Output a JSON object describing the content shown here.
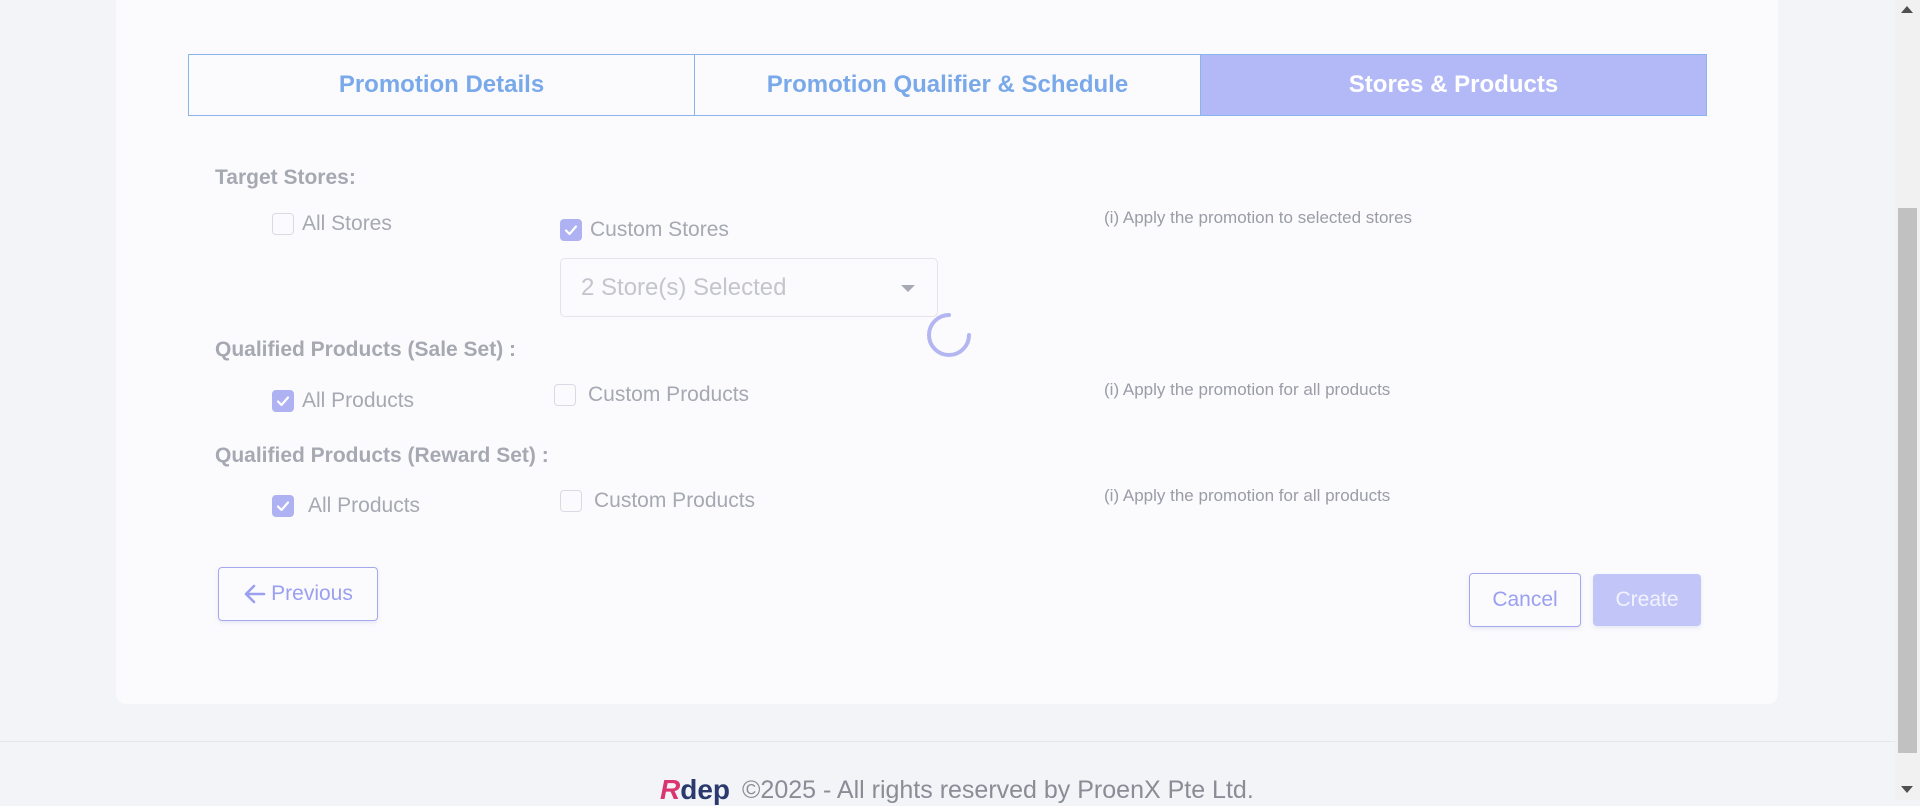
{
  "tabs": [
    {
      "label": "Promotion Details",
      "active": false
    },
    {
      "label": "Promotion Qualifier & Schedule",
      "active": false
    },
    {
      "label": "Stores & Products",
      "active": true
    }
  ],
  "target_stores": {
    "label": "Target Stores:",
    "all_label": "All Stores",
    "all_checked": false,
    "custom_label": "Custom Stores",
    "custom_checked": true,
    "select_value": "2 Store(s) Selected",
    "hint": "(i) Apply the promotion to selected stores"
  },
  "sale_set": {
    "label": "Qualified Products (Sale Set) :",
    "all_label": "All Products",
    "all_checked": true,
    "custom_label": "Custom Products",
    "custom_checked": false,
    "hint": "(i) Apply the promotion for all products"
  },
  "reward_set": {
    "label": "Qualified Products (Reward Set) :",
    "all_label": "All Products",
    "all_checked": true,
    "custom_label": "Custom Products",
    "custom_checked": false,
    "hint": "(i) Apply the promotion for all products"
  },
  "buttons": {
    "previous": "Previous",
    "cancel": "Cancel",
    "create": "Create"
  },
  "footer": {
    "logo_r": "R",
    "logo_rest": "dep",
    "copyright": "©2025 - All rights reserved by ProenX Pte Ltd."
  },
  "colors": {
    "accent": "#aeb2f2",
    "tab_active": "#b3b9f6",
    "tab_text": "#7aa9ea",
    "logo_red": "#d9356e",
    "logo_navy": "#2b3a6e"
  },
  "icons": {
    "check": "check-icon",
    "caret": "chevron-down-icon",
    "arrow": "arrow-left-icon",
    "spinner": "loading-spinner-icon"
  }
}
